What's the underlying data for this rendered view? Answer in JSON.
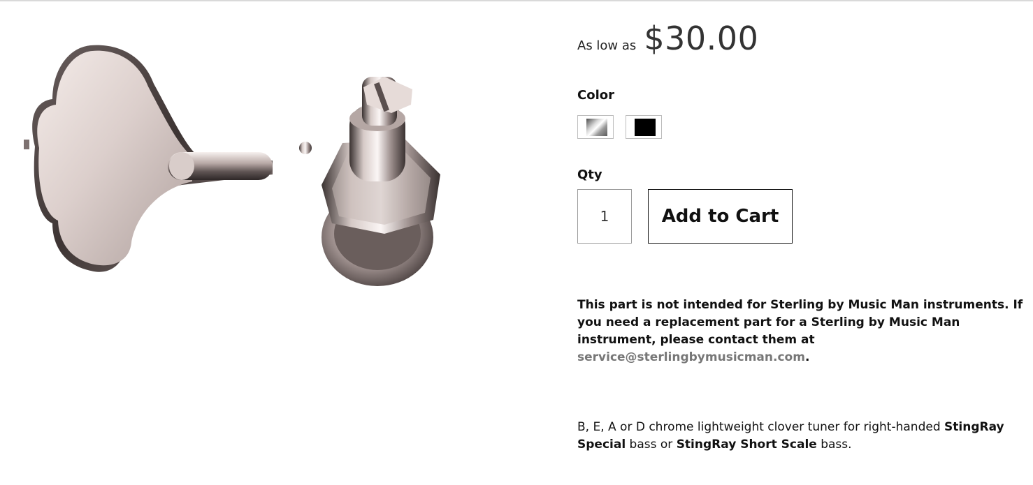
{
  "product": {
    "image_alt": "chrome clover bass tuner"
  },
  "price": {
    "prefix": "As low as",
    "value": "$30.00"
  },
  "color": {
    "label": "Color",
    "options": [
      {
        "name": "Chrome",
        "swatch": "chrome-gradient",
        "selected": true
      },
      {
        "name": "Black",
        "swatch": "#000000",
        "selected": false
      }
    ]
  },
  "qty": {
    "label": "Qty",
    "value": "1"
  },
  "cart": {
    "button_label": "Add to Cart"
  },
  "notice": {
    "text_before": "This part is not intended for Sterling by Music Man instruments. If you need a replacement part for a Sterling by Music Man instrument, please contact them at ",
    "email": "service@sterlingbymusicman.com",
    "text_after": "."
  },
  "description": {
    "part1": "B, E, A or D chrome lightweight clover tuner for right-handed ",
    "bold1": "StingRay Special",
    "part2": " bass or ",
    "bold2": "StingRay Short Scale",
    "part3": " bass."
  },
  "colors": {
    "link": "#777777",
    "text": "#111111",
    "price": "#333333"
  }
}
